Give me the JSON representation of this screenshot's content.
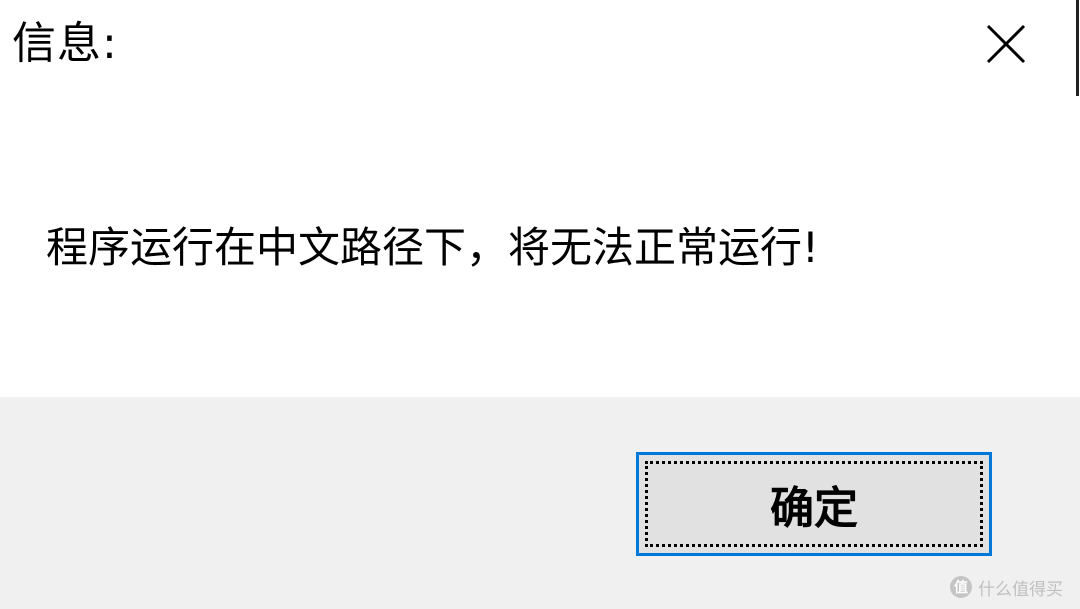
{
  "dialog": {
    "title": "信息:",
    "message": "程序运行在中文路径下，将无法正常运行!",
    "ok_label": "确定",
    "close_icon": "close-icon",
    "accent_color": "#0078d7",
    "footer_color": "#f0f0f0"
  },
  "watermark": {
    "logo_glyph": "值",
    "text": "什么值得买"
  }
}
